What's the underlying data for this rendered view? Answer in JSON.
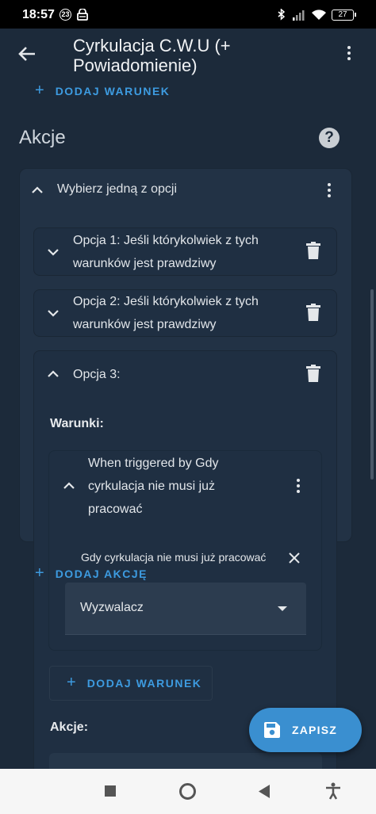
{
  "status_bar": {
    "time": "18:57",
    "notification_badge": "23",
    "battery": "27",
    "icons": [
      "lock-icon",
      "bluetooth-icon",
      "signal-icon",
      "wifi-icon",
      "battery-icon"
    ]
  },
  "app_bar": {
    "title": "Cyrkulacja C.W.U (+ Powiadomienie)",
    "back_icon": "arrow-left-icon",
    "menu_icon": "more-vertical-icon"
  },
  "add_condition_top": {
    "label": "DODAJ WARUNEK"
  },
  "actions_section": {
    "title": "Akcje",
    "help_icon": "help-circle-icon",
    "help_glyph": "?"
  },
  "choose_card": {
    "label": "Wybierz jedną z opcji",
    "options": [
      {
        "text": "Opcja 1: Jeśli którykolwiek z tych warunków jest prawdziwy"
      },
      {
        "text": "Opcja 2: Jeśli którykolwiek z tych warunków jest prawdziwy"
      },
      {
        "text": "Opcja 3:"
      }
    ],
    "conditions_label": "Warunki:",
    "trigger_card": {
      "text": "When triggered by Gdy cyrkulacja nie musi już pracować",
      "tooltip": "Gdy cyrkulacja nie musi już pracować",
      "select_value": "Wyzwalacz"
    },
    "add_condition_inner": "DODAJ WARUNEK",
    "actions_label": "Akcje:"
  },
  "add_action": {
    "label": "DODAJ AKCJĘ"
  },
  "fab": {
    "label": "ZAPISZ",
    "icon": "save-icon"
  },
  "colors": {
    "background": "#1c2a3a",
    "card": "#223245",
    "accent": "#3d9be0",
    "fab": "#3a8fd0"
  }
}
